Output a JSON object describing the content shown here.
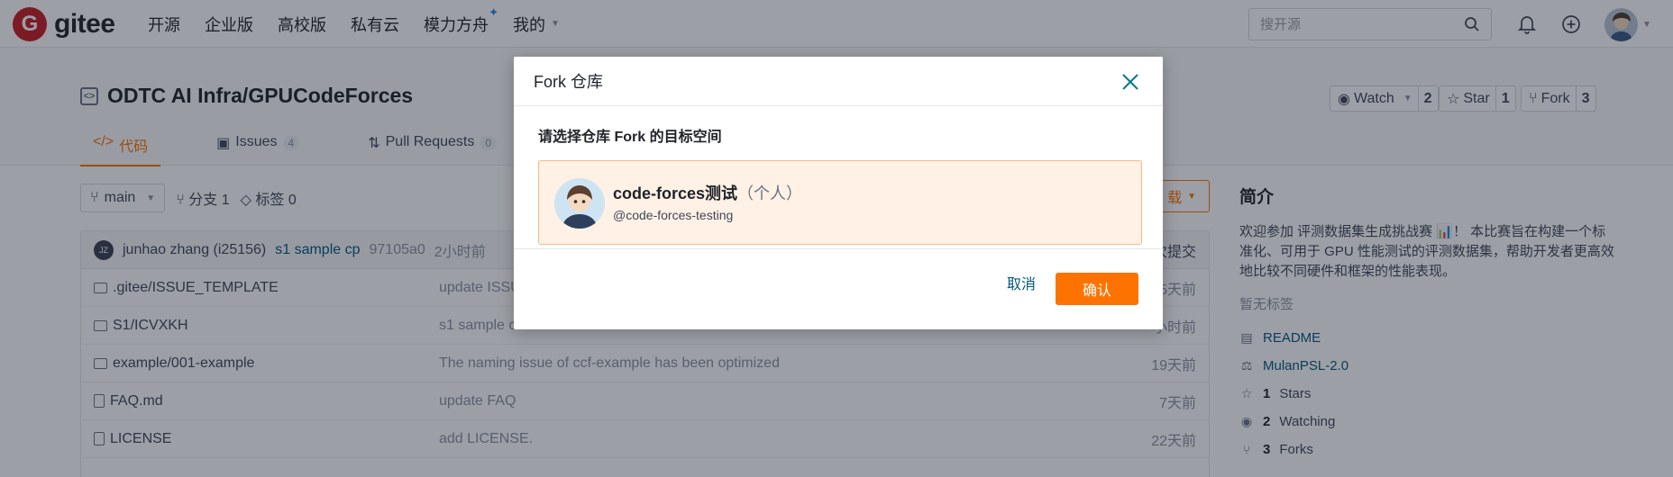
{
  "nav": {
    "logo_text": "gitee",
    "links": [
      "开源",
      "企业版",
      "高校版",
      "私有云",
      "模力方舟",
      "我的"
    ],
    "search_placeholder": "搜开源"
  },
  "repo": {
    "title": "ODTC AI Infra/GPUCodeForces",
    "watch": {
      "label": "Watch",
      "count": "2"
    },
    "star": {
      "label": "Star",
      "count": "1"
    },
    "fork": {
      "label": "Fork",
      "count": "3"
    },
    "tabs": [
      {
        "label": "代码"
      },
      {
        "label": "Issues",
        "count": "4"
      },
      {
        "label": "Pull Requests",
        "count": "0"
      }
    ]
  },
  "toolbar": {
    "branch": "main",
    "branches": "分支 1",
    "tags": "标签 0",
    "clone_label": "载"
  },
  "commit": {
    "author": "junhao zhang (i25156)",
    "avatar_initials": "JZ",
    "message": "s1 sample cp",
    "hash": "97105a0",
    "time": "2小时前",
    "right": "次提交"
  },
  "files": [
    {
      "name": ".gitee/ISSUE_TEMPLATE",
      "message": "update ISSU",
      "time": "5天前",
      "type": "folder"
    },
    {
      "name": "S1/ICVXKH",
      "message": "s1 sample c",
      "time": "小时前",
      "type": "folder"
    },
    {
      "name": "example/001-example",
      "message": "The naming issue of ccf-example has been optimized",
      "time": "19天前",
      "type": "folder"
    },
    {
      "name": "FAQ.md",
      "message": "update FAQ",
      "time": "7天前",
      "type": "file"
    },
    {
      "name": "LICENSE",
      "message": "add LICENSE.",
      "time": "22天前",
      "type": "file"
    }
  ],
  "sidebar": {
    "heading": "简介",
    "intro": "欢迎参加 评测数据集生成挑战赛 📊！ 本比赛旨在构建一个标准化、可用于 GPU 性能测试的评测数据集，帮助开发者更高效地比较不同硬件和框架的性能表现。",
    "no_tags": "暂无标签",
    "readme": "README",
    "license": "MulanPSL-2.0",
    "stars": {
      "count": "1",
      "label": "Stars"
    },
    "watching": {
      "count": "2",
      "label": "Watching"
    },
    "forks": {
      "count": "3",
      "label": "Forks"
    }
  },
  "modal": {
    "title": "Fork 仓库",
    "question": "请选择仓库 Fork 的目标空间",
    "target_name": "code-forces测试",
    "target_type": "（个人）",
    "target_handle": "@code-forces-testing",
    "cancel": "取消",
    "confirm": "确认"
  },
  "colors": {
    "brand": "#c71d23",
    "accent": "#fe7300",
    "link": "#005980"
  }
}
